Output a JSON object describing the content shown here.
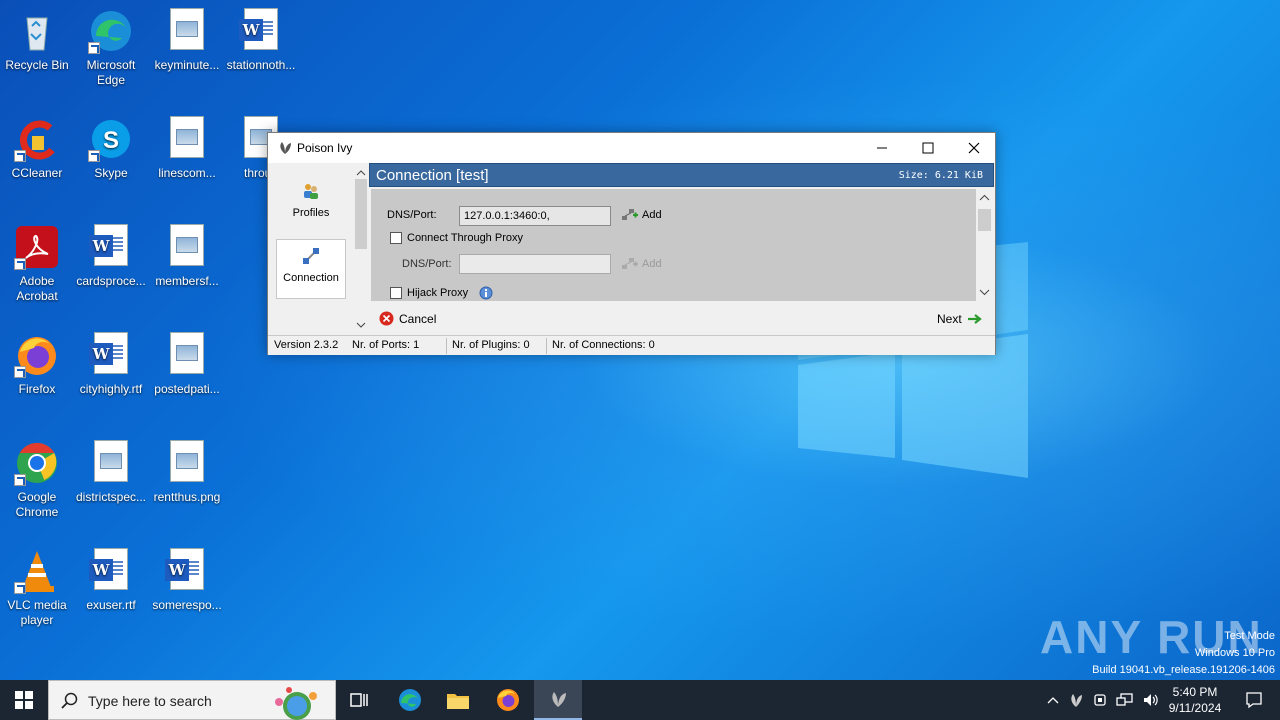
{
  "desktop": {
    "icons": [
      {
        "label": "Recycle Bin"
      },
      {
        "label": "Microsoft Edge"
      },
      {
        "label": "keyminute..."
      },
      {
        "label": "stationnoth..."
      },
      {
        "label": "CCleaner"
      },
      {
        "label": "Skype"
      },
      {
        "label": "linescom..."
      },
      {
        "label": "throug"
      },
      {
        "label": "Adobe Acrobat"
      },
      {
        "label": "cardsproce..."
      },
      {
        "label": "membersf..."
      },
      {
        "label": "Firefox"
      },
      {
        "label": "cityhighly.rtf"
      },
      {
        "label": "postedpati..."
      },
      {
        "label": "Google Chrome"
      },
      {
        "label": "districtspec..."
      },
      {
        "label": "rentthus.png"
      },
      {
        "label": "VLC media player"
      },
      {
        "label": "exuser.rtf"
      },
      {
        "label": "somerespo..."
      }
    ]
  },
  "window": {
    "title": "Poison Ivy",
    "nav": [
      {
        "label": "Profiles"
      },
      {
        "label": "Connection"
      }
    ],
    "header": {
      "title": "Connection [test]",
      "size": "Size: 6.21 KiB"
    },
    "form": {
      "dns_label": "DNS/Port:",
      "dns_value": "127.0.0.1:3460:0,",
      "add_label": "Add",
      "proxy_label": "Connect Through Proxy",
      "proxy_dns_label": "DNS/Port:",
      "proxy_dns_value": "",
      "proxy_add_label": "Add",
      "hijack_label": "Hijack Proxy"
    },
    "buttons": {
      "cancel": "Cancel",
      "next": "Next"
    },
    "status": {
      "version": "Version 2.3.2",
      "ports": "Nr. of Ports: 1",
      "plugins": "Nr. of Plugins: 0",
      "connections": "Nr. of Connections: 0"
    }
  },
  "watermark": {
    "brand": "ANY RUN",
    "line1": "Test Mode",
    "line2": "Windows 10 Pro",
    "line3": "Build 19041.vb_release.191206-1406"
  },
  "taskbar": {
    "search_placeholder": "Type here to search",
    "time": "5:40 PM",
    "date": "9/11/2024"
  },
  "colors": {
    "header_bar": "#39689e",
    "taskbar": "#1c2633",
    "desktop": "#0a6fd6"
  }
}
